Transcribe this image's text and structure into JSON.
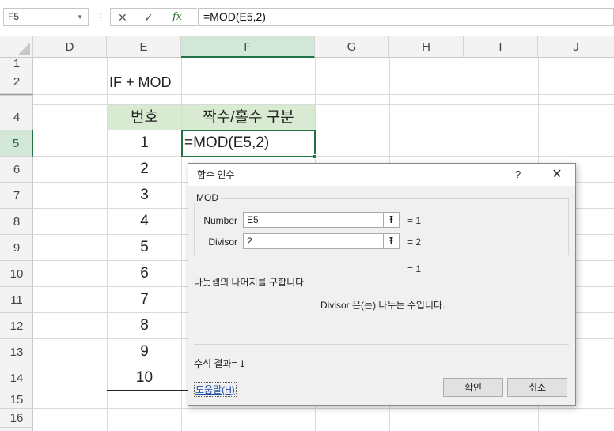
{
  "formula_bar": {
    "name_box": "F5",
    "separator": "⋮",
    "cancel_icon": "✕",
    "enter_icon": "✓",
    "fx_label": "fx",
    "formula": "=MOD(E5,2)"
  },
  "columns": [
    "D",
    "E",
    "F",
    "G",
    "H",
    "I",
    "J"
  ],
  "selected_column": "F",
  "rows": [
    "1",
    "2",
    "4",
    "5",
    "6",
    "7",
    "8",
    "9",
    "10",
    "11",
    "12",
    "13",
    "14",
    "15",
    "16"
  ],
  "selected_row": "5",
  "cells": {
    "title": "IF + MOD",
    "header_number": "번호",
    "header_parity": "짝수/홀수 구분",
    "active_formula": "=MOD(E5,2)",
    "numbers": [
      "1",
      "2",
      "3",
      "4",
      "5",
      "6",
      "7",
      "8",
      "9",
      "10"
    ]
  },
  "dialog": {
    "title": "함수 인수",
    "help": "?",
    "close": "✕",
    "group_label": "MOD",
    "args": [
      {
        "label": "Number",
        "value": "E5",
        "result": "=  1"
      },
      {
        "label": "Divisor",
        "value": "2",
        "result": "=  2"
      }
    ],
    "collapse_icon": "⭱",
    "formula_result_inline": "=  1",
    "description": "나눗셈의 나머지를 구합니다.",
    "arg_description": "Divisor  은(는) 나누는 수입니다.",
    "result_label": "수식 결과=  1",
    "help_link": "도움말(H)",
    "ok": "확인",
    "cancel": "취소"
  },
  "colors": {
    "accent_green": "#217346",
    "header_fill": "#d9ead3",
    "selected_header": "#d3e7d9"
  }
}
